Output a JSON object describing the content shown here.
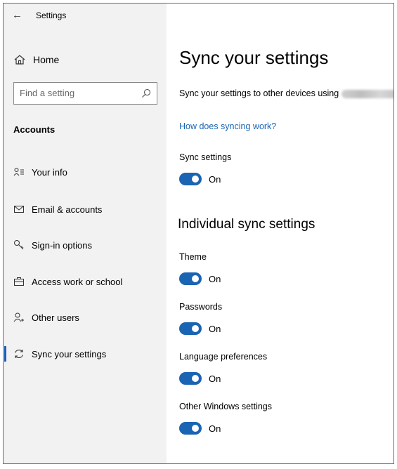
{
  "window": {
    "title": "Settings"
  },
  "sidebar": {
    "home_label": "Home",
    "search_placeholder": "Find a setting",
    "section_label": "Accounts",
    "items": [
      {
        "label": "Your info",
        "icon": "person-list-icon"
      },
      {
        "label": "Email & accounts",
        "icon": "mail-icon"
      },
      {
        "label": "Sign-in options",
        "icon": "key-icon"
      },
      {
        "label": "Access work or school",
        "icon": "briefcase-icon"
      },
      {
        "label": "Other users",
        "icon": "person-add-icon"
      },
      {
        "label": "Sync your settings",
        "icon": "sync-icon",
        "selected": true
      }
    ]
  },
  "main": {
    "title": "Sync your settings",
    "description": "Sync your settings to other devices using",
    "link": "How does syncing work?",
    "sync_settings": {
      "label": "Sync settings",
      "state": "On"
    },
    "individual_title": "Individual sync settings",
    "toggles": [
      {
        "label": "Theme",
        "state": "On"
      },
      {
        "label": "Passwords",
        "state": "On"
      },
      {
        "label": "Language preferences",
        "state": "On"
      },
      {
        "label": "Other Windows settings",
        "state": "On"
      }
    ]
  },
  "colors": {
    "accent": "#1a64b4",
    "sidebar_bg": "#f2f2f2",
    "content_bg": "#ffffff"
  }
}
